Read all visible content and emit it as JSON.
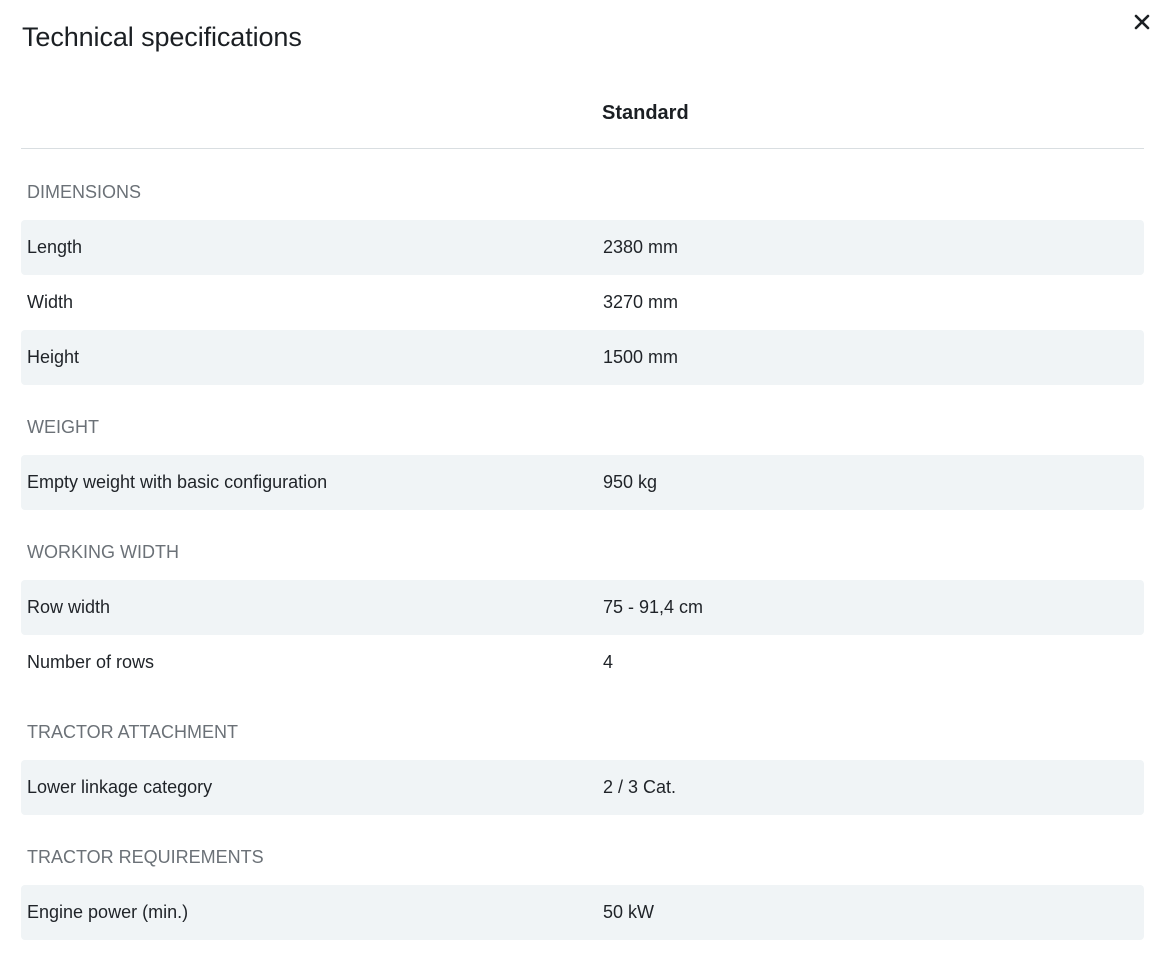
{
  "modal": {
    "title": "Technical specifications",
    "close_icon": "close-icon"
  },
  "table": {
    "column_header": "Standard"
  },
  "sections": [
    {
      "title": "DIMENSIONS",
      "rows": [
        {
          "label": "Length",
          "value": "2380 mm"
        },
        {
          "label": "Width",
          "value": "3270 mm"
        },
        {
          "label": "Height",
          "value": "1500 mm"
        }
      ]
    },
    {
      "title": "WEIGHT",
      "rows": [
        {
          "label": "Empty weight with basic configuration",
          "value": "950 kg"
        }
      ]
    },
    {
      "title": "WORKING WIDTH",
      "rows": [
        {
          "label": "Row width",
          "value": "75 - 91,4 cm"
        },
        {
          "label": "Number of rows",
          "value": "4"
        }
      ]
    },
    {
      "title": "TRACTOR ATTACHMENT",
      "rows": [
        {
          "label": "Lower linkage category",
          "value": "2 / 3 Cat."
        }
      ]
    },
    {
      "title": "TRACTOR REQUIREMENTS",
      "rows": [
        {
          "label": "Engine power (min.)",
          "value": "50 kW"
        }
      ]
    }
  ],
  "colors": {
    "row_shade": "#f0f4f6",
    "section_title": "#6b7177",
    "text": "#1f2328",
    "divider": "#d9dee1"
  }
}
